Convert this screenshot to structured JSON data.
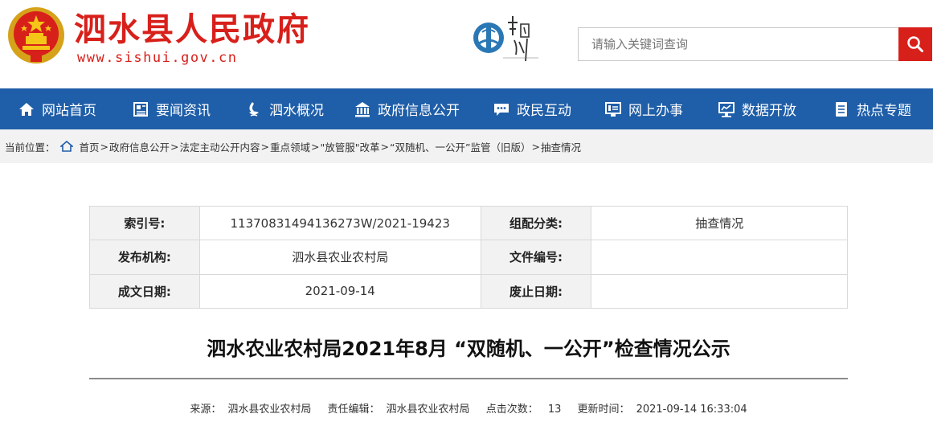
{
  "header": {
    "site_title": "泗水县人民政府",
    "site_url": "www.sishui.gov.cn",
    "search_placeholder": "请输入关键词查询",
    "brand_color": "#d8201b"
  },
  "nav": {
    "bg_color": "#1f5ea8",
    "items": [
      {
        "label": "网站首页",
        "icon": "home-icon"
      },
      {
        "label": "要闻资讯",
        "icon": "news-icon"
      },
      {
        "label": "泗水概况",
        "icon": "water-icon"
      },
      {
        "label": "政府信息公开",
        "icon": "government-icon"
      },
      {
        "label": "政民互动",
        "icon": "chat-icon"
      },
      {
        "label": "网上办事",
        "icon": "service-icon"
      },
      {
        "label": "数据开放",
        "icon": "data-icon"
      },
      {
        "label": "热点专题",
        "icon": "topic-icon"
      }
    ]
  },
  "breadcrumb": {
    "prefix": "当前位置：",
    "items": [
      "首页",
      "政府信息公开",
      "法定主动公开内容",
      "重点领域",
      "\"放管服\"改革",
      " “双随机、一公开”监管（旧版）",
      "抽查情况"
    ]
  },
  "info": {
    "index_label": "索引号:",
    "index_value": "11370831494136273W/2021-19423",
    "category_label": "组配分类:",
    "category_value": "抽查情况",
    "publisher_label": "发布机构:",
    "publisher_value": "泗水县农业农村局",
    "doc_no_label": "文件编号:",
    "doc_no_value": "",
    "date_label": "成文日期:",
    "date_value": "2021-09-14",
    "expire_label": "废止日期:",
    "expire_value": ""
  },
  "article": {
    "title": "泗水农业农村局2021年8月 “双随机、一公开”检查情况公示",
    "source_label": "来源：",
    "source_value": "泗水县农业农村局",
    "editor_label": "责任编辑：",
    "editor_value": "泗水县农业农村局",
    "clicks_label": "点击次数：",
    "clicks_value": "13",
    "updated_label": "更新时间：",
    "updated_value": "2021-09-14 16:33:04"
  }
}
